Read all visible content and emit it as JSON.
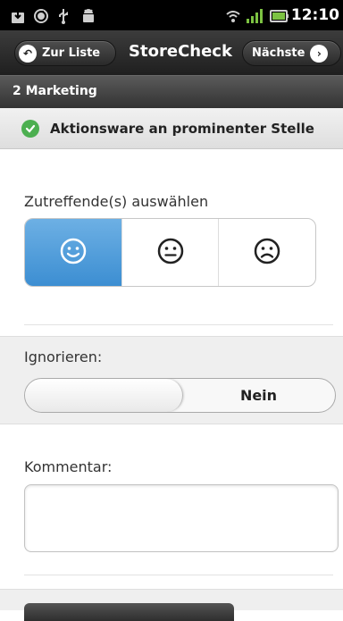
{
  "status_bar": {
    "time": "12:10",
    "icons": [
      "download-icon",
      "sync-icon",
      "usb-icon",
      "android-icon",
      "wifi-icon",
      "signal-icon",
      "battery-icon"
    ]
  },
  "header": {
    "back_label": "Zur Liste",
    "title": "StoreCheck",
    "next_label": "Nächste"
  },
  "section": {
    "title": "2 Marketing"
  },
  "item": {
    "label": "Aktionsware an prominenter Stelle",
    "status": "checked"
  },
  "rating": {
    "label": "Zutreffende(s) auswählen",
    "options": [
      "happy",
      "neutral",
      "sad"
    ],
    "selected": "happy"
  },
  "ignore": {
    "label": "Ignorieren:",
    "value": "Nein"
  },
  "comment": {
    "label": "Kommentar:",
    "value": ""
  },
  "colors": {
    "accent": "#4a9ad9",
    "check": "#4caf50",
    "header": "#2a2a2a"
  }
}
